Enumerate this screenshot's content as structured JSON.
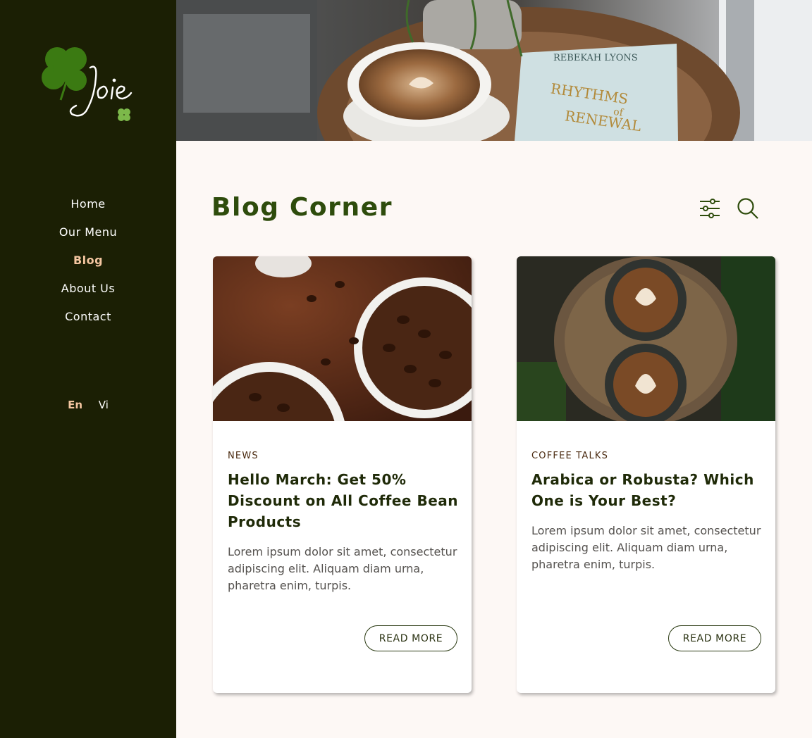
{
  "brand": {
    "name": "Joie"
  },
  "nav": {
    "items": [
      {
        "label": "Home"
      },
      {
        "label": "Our Menu"
      },
      {
        "label": "Blog"
      },
      {
        "label": "About Us"
      },
      {
        "label": "Contact"
      }
    ],
    "active": "Blog"
  },
  "languages": {
    "en": "En",
    "vi": "Vi",
    "active": "En"
  },
  "hero": {
    "book_author": "REBEKAH LYONS",
    "book_title_line1": "RHYTHMS",
    "book_title_line2": "of",
    "book_title_line3": "RENEWAL"
  },
  "page": {
    "title": "Blog Corner",
    "filter_icon": "filter-sliders-icon",
    "search_icon": "search-icon"
  },
  "posts": [
    {
      "category": "NEWS",
      "title": "Hello March: Get 50% Discount on All Coffee Bean Products",
      "excerpt": "Lorem ipsum dolor sit amet, consectetur adipiscing elit. Aliquam diam urna, pharetra enim, turpis.",
      "cta": "READ MORE"
    },
    {
      "category": "COFFEE TALKS",
      "title": "Arabica or Robusta? Which One is Your Best?",
      "excerpt": "Lorem ipsum dolor sit amet, consectetur adipiscing elit. Aliquam diam urna, pharetra enim, turpis.",
      "cta": "READ MORE"
    }
  ],
  "colors": {
    "sidebar_bg": "#1b1f04",
    "accent_active": "#f4c6a1",
    "title_green": "#2e4c0c",
    "page_bg": "#fdf8f5"
  }
}
